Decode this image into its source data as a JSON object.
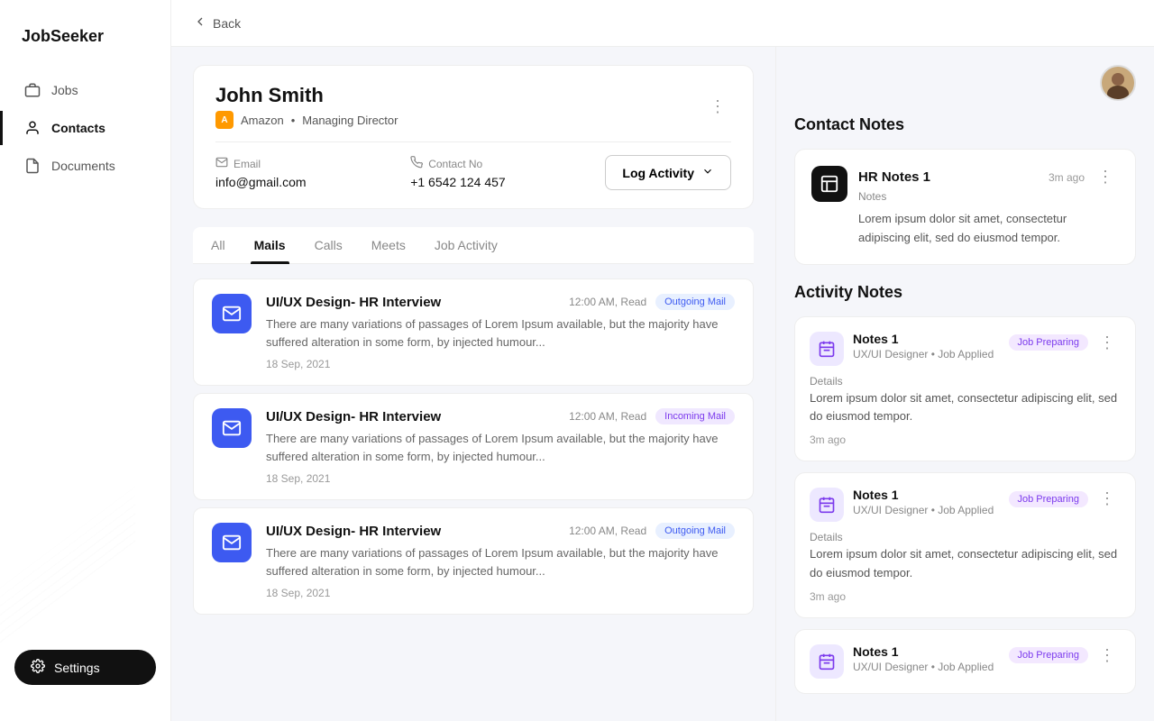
{
  "app": {
    "name": "JobSeeker"
  },
  "sidebar": {
    "items": [
      {
        "label": "Jobs",
        "icon": "briefcase-icon",
        "active": false
      },
      {
        "label": "Contacts",
        "icon": "contacts-icon",
        "active": true
      },
      {
        "label": "Documents",
        "icon": "documents-icon",
        "active": false
      }
    ],
    "settings_label": "Settings"
  },
  "topbar": {
    "back_label": "Back"
  },
  "contact": {
    "name": "John Smith",
    "company": "Amazon",
    "role": "Managing Director",
    "email_label": "Email",
    "email_value": "info@gmail.com",
    "phone_label": "Contact No",
    "phone_value": "+1 6542 124 457",
    "log_activity_label": "Log Activity"
  },
  "tabs": [
    {
      "label": "All",
      "active": false
    },
    {
      "label": "Mails",
      "active": true
    },
    {
      "label": "Calls",
      "active": false
    },
    {
      "label": "Meets",
      "active": false
    },
    {
      "label": "Job Activity",
      "active": false
    }
  ],
  "mails": [
    {
      "title": "UI/UX Design- HR Interview",
      "time": "12:00 AM, Read",
      "badge": "Outgoing Mail",
      "badge_type": "outgoing",
      "preview": "There are many variations of passages of Lorem Ipsum available, but the majority have suffered alteration in some form, by injected humour...",
      "date": "18 Sep, 2021"
    },
    {
      "title": "UI/UX Design- HR Interview",
      "time": "12:00 AM, Read",
      "badge": "Incoming Mail",
      "badge_type": "incoming",
      "preview": "There are many variations of passages of Lorem Ipsum available, but the majority have suffered alteration in some form, by injected humour...",
      "date": "18 Sep, 2021"
    },
    {
      "title": "UI/UX Design- HR Interview",
      "time": "12:00 AM, Read",
      "badge": "Outgoing Mail",
      "badge_type": "outgoing",
      "preview": "There are many variations of passages of Lorem Ipsum available, but the majority have suffered alteration in some form, by injected humour...",
      "date": "18 Sep, 2021"
    }
  ],
  "contact_notes": {
    "section_title": "Contact Notes",
    "notes": [
      {
        "title": "HR Notes 1",
        "time": "3m ago",
        "type": "Notes",
        "body": "Lorem ipsum dolor sit amet, consectetur adipiscing elit, sed do eiusmod tempor."
      }
    ]
  },
  "activity_notes": {
    "section_title": "Activity Notes",
    "notes": [
      {
        "title": "Notes 1",
        "sub": "UX/UI Designer • Job Applied",
        "badge": "Job Preparing",
        "details_label": "Details",
        "details": "Lorem ipsum dolor sit amet, consectetur adipiscing elit, sed do eiusmod tempor.",
        "ago": "3m ago"
      },
      {
        "title": "Notes 1",
        "sub": "UX/UI Designer • Job Applied",
        "badge": "Job Preparing",
        "details_label": "Details",
        "details": "Lorem ipsum dolor sit amet, consectetur adipiscing elit, sed do eiusmod tempor.",
        "ago": "3m ago"
      },
      {
        "title": "Notes 1",
        "sub": "UX/UI Designer • Job Applied",
        "badge": "Job Preparing",
        "details_label": "Details",
        "details": "",
        "ago": ""
      }
    ]
  }
}
